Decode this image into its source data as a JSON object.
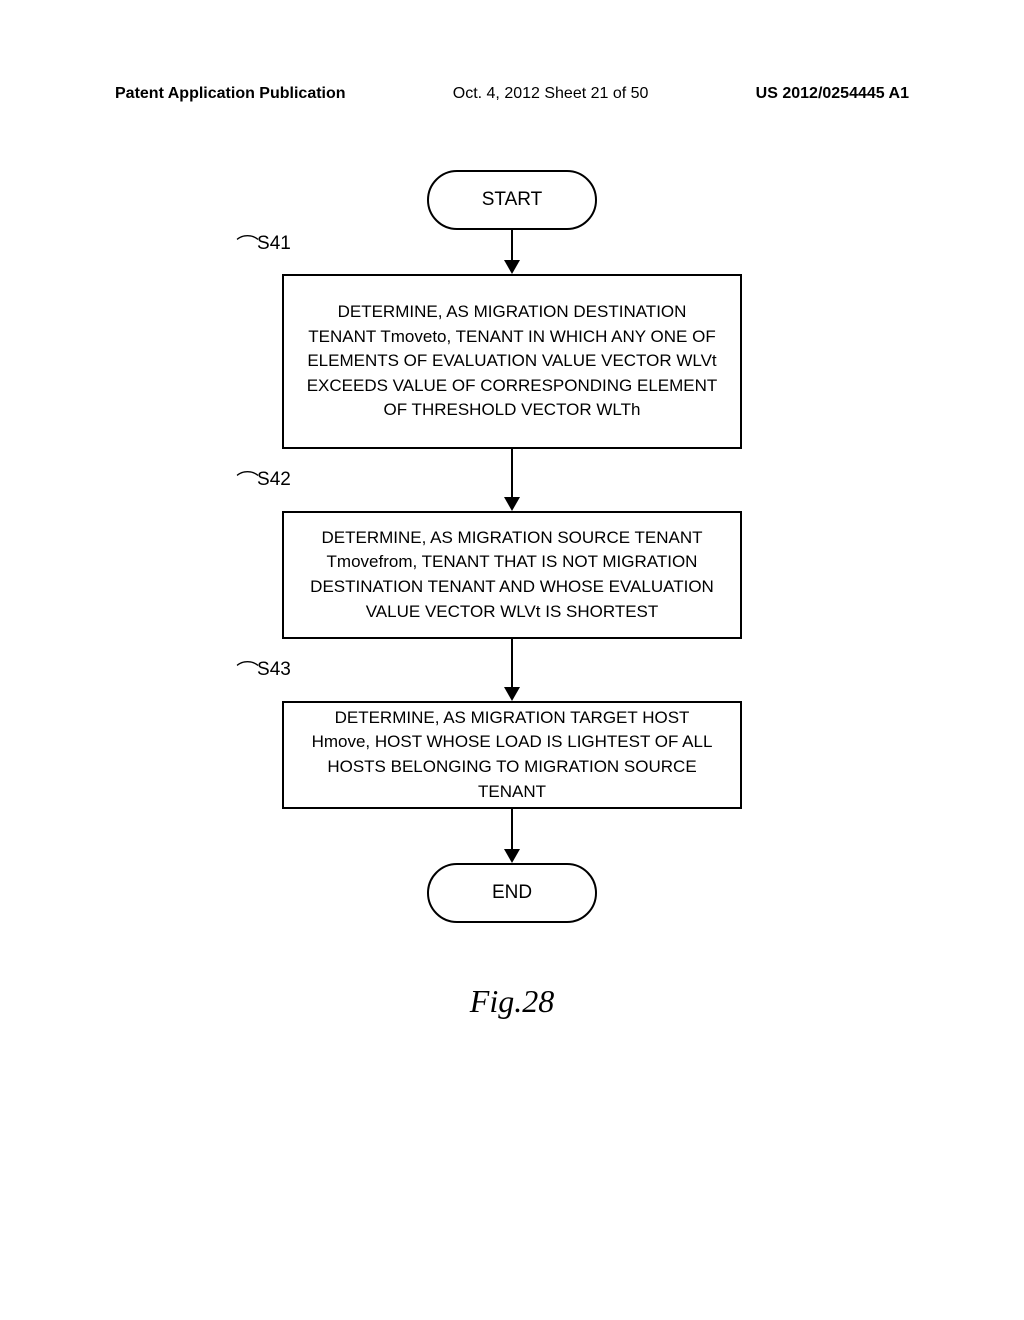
{
  "header": {
    "left": "Patent Application Publication",
    "center": "Oct. 4, 2012  Sheet 21 of 50",
    "right": "US 2012/0254445 A1"
  },
  "flowchart": {
    "start": "START",
    "end": "END",
    "steps": [
      {
        "label": "S41",
        "text": "DETERMINE, AS MIGRATION DESTINATION TENANT Tmoveto, TENANT IN WHICH ANY ONE OF ELEMENTS OF EVALUATION VALUE VECTOR WLVt EXCEEDS VALUE OF CORRESPONDING ELEMENT OF THRESHOLD VECTOR WLTh"
      },
      {
        "label": "S42",
        "text": "DETERMINE, AS MIGRATION SOURCE TENANT Tmovefrom, TENANT THAT IS NOT MIGRATION DESTINATION TENANT AND WHOSE EVALUATION VALUE VECTOR WLVt IS SHORTEST"
      },
      {
        "label": "S43",
        "text": "DETERMINE, AS MIGRATION TARGET HOST Hmove, HOST WHOSE LOAD IS LIGHTEST OF ALL HOSTS BELONGING TO MIGRATION SOURCE TENANT"
      }
    ],
    "figure_label": "Fig.28"
  }
}
